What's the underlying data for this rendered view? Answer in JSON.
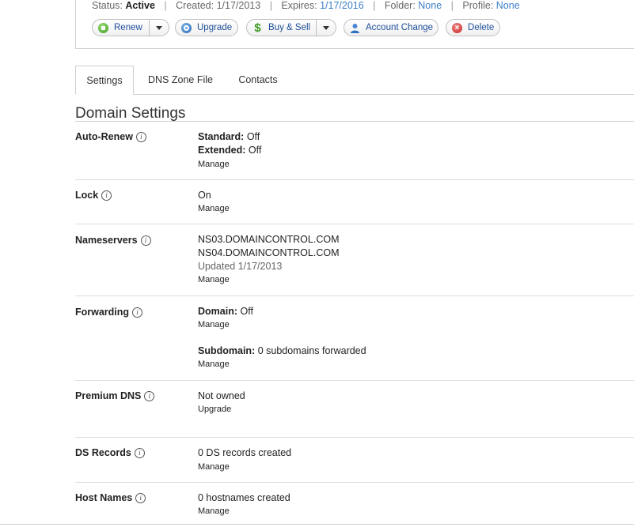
{
  "header": {
    "status_label": "Status:",
    "status_value": "Active",
    "created_label": "Created:",
    "created_value": "1/17/2013",
    "expires_label": "Expires:",
    "expires_value": "1/17/2016",
    "folder_label": "Folder:",
    "folder_value": "None",
    "profile_label": "Profile:",
    "profile_value": "None",
    "separator": "|"
  },
  "actions": {
    "renew": "Renew",
    "upgrade": "Upgrade",
    "buy_sell": "Buy & Sell",
    "account_change": "Account Change",
    "delete": "Delete"
  },
  "tabs": [
    {
      "label": "Settings",
      "active": true
    },
    {
      "label": "DNS Zone File",
      "active": false
    },
    {
      "label": "Contacts",
      "active": false
    }
  ],
  "section_title": "Domain Settings",
  "info_glyph": "i",
  "settings": {
    "auto_renew": {
      "label": "Auto-Renew",
      "standard_label": "Standard:",
      "standard_value": "Off",
      "extended_label": "Extended:",
      "extended_value": "Off",
      "link": "Manage"
    },
    "lock": {
      "label": "Lock",
      "value": "On",
      "link": "Manage"
    },
    "nameservers": {
      "label": "Nameservers",
      "ns1": "NS03.DOMAINCONTROL.COM",
      "ns2": "NS04.DOMAINCONTROL.COM",
      "updated": "Updated 1/17/2013",
      "link": "Manage"
    },
    "forwarding": {
      "label": "Forwarding",
      "domain_label": "Domain:",
      "domain_value": "Off",
      "domain_link": "Manage",
      "subdomain_label": "Subdomain:",
      "subdomain_value": "0 subdomains forwarded",
      "subdomain_link": "Manage"
    },
    "premium_dns": {
      "label": "Premium DNS",
      "value": "Not owned",
      "link": "Upgrade"
    },
    "ds_records": {
      "label": "DS Records",
      "value": "0 DS records created",
      "link": "Manage"
    },
    "host_names": {
      "label": "Host Names",
      "value": "0 hostnames created",
      "link": "Manage"
    }
  }
}
